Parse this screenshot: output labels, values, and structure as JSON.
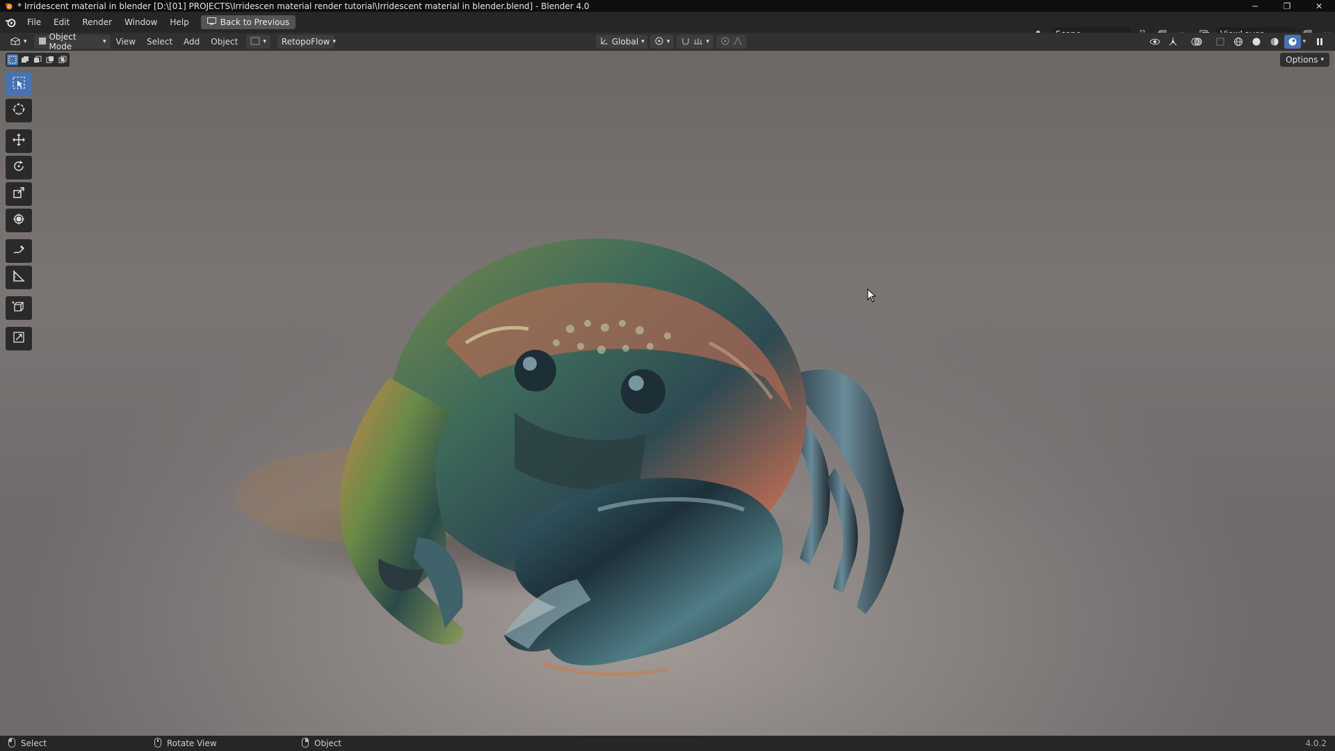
{
  "window": {
    "title": "* Irridescent material in blender [D:\\[01] PROJECTS\\Irridescen material render tutorial\\Irridescent material in blender.blend] - Blender 4.0",
    "minimize": "─",
    "maximize": "❐",
    "close": "✕"
  },
  "topbar": {
    "menus": [
      "File",
      "Edit",
      "Render",
      "Window",
      "Help"
    ],
    "back_button": "Back to Previous",
    "scene": "Scene",
    "view_layer": "ViewLayer"
  },
  "header": {
    "mode": "Object Mode",
    "menus": [
      "View",
      "Select",
      "Add",
      "Object"
    ],
    "addon": "RetopoFlow",
    "orientation": "Global"
  },
  "viewport": {
    "options": "Options"
  },
  "status": {
    "left_click": "Select",
    "middle_click": "Rotate View",
    "right_click": "Object",
    "version": "4.0.2"
  },
  "colors": {
    "accent": "#4772b3",
    "blender_orange": "#e87d0d"
  },
  "icons": {
    "tools": [
      "select-box-icon",
      "cursor-icon",
      "move-icon",
      "rotate-icon",
      "scale-icon",
      "transform-icon",
      "annotate-icon",
      "measure-icon",
      "add-cube-icon",
      "scale-cage-icon"
    ]
  }
}
